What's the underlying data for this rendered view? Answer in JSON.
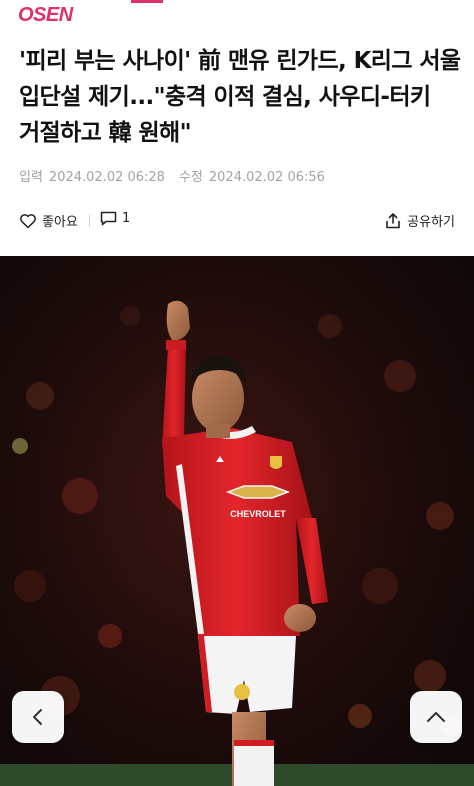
{
  "header": {
    "logo_text": "OSEN",
    "accent_color": "#e0306a"
  },
  "article": {
    "title": "'피리 부는 사나이' 前 맨유 린가드, K리그 서울 입단설 제기...\"충격 이적 결심, 사우디-터키 거절하고 韓 원해\"",
    "meta": {
      "published_label": "입력",
      "published": "2024.02.02 06:28",
      "modified_label": "수정",
      "modified": "2024.02.02 06:56"
    }
  },
  "actions": {
    "like_label": "좋아요",
    "comment_count": "1",
    "share_label": "공유하기"
  },
  "photo": {
    "sponsor_text": "CHEVROLET",
    "icon_names": [
      "heart-icon",
      "comment-icon",
      "share-icon",
      "chevron-left-icon",
      "chevron-up-icon"
    ]
  }
}
